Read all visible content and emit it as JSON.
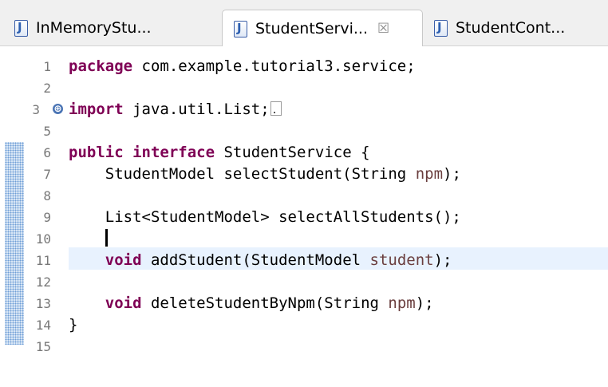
{
  "tabs": [
    {
      "label": "InMemoryStu...",
      "icon": "java-file-icon",
      "active": false
    },
    {
      "label": "StudentServi...",
      "icon": "java-file-icon",
      "active": true,
      "close_glyph": "☒"
    },
    {
      "label": "StudentCont...",
      "icon": "java-file-icon",
      "active": false
    }
  ],
  "editor": {
    "lines": [
      {
        "n": "1",
        "tokens": [
          {
            "t": "package",
            "k": "kw"
          },
          {
            "t": " com.example.tutorial3.service;"
          }
        ]
      },
      {
        "n": "2",
        "tokens": []
      },
      {
        "n": "3",
        "fold": "⊕",
        "tokens": [
          {
            "t": "import",
            "k": "kw"
          },
          {
            "t": " java.util.List;"
          }
        ],
        "collapsed": true
      },
      {
        "n": "5",
        "tokens": []
      },
      {
        "n": "6",
        "tokens": [
          {
            "t": "public",
            "k": "kw"
          },
          {
            "t": " "
          },
          {
            "t": "interface",
            "k": "kw"
          },
          {
            "t": " StudentService {"
          }
        ]
      },
      {
        "n": "7",
        "tokens": [
          {
            "t": "    StudentModel selectStudent(String "
          },
          {
            "t": "npm",
            "k": "param"
          },
          {
            "t": ");"
          }
        ]
      },
      {
        "n": "8",
        "tokens": []
      },
      {
        "n": "9",
        "tokens": [
          {
            "t": "    List<StudentModel> selectAllStudents();"
          }
        ]
      },
      {
        "n": "10",
        "tokens": [
          {
            "t": "    "
          }
        ],
        "caret": true,
        "current": true
      },
      {
        "n": "11",
        "tokens": [
          {
            "t": "    "
          },
          {
            "t": "void",
            "k": "kw"
          },
          {
            "t": " addStudent(StudentModel "
          },
          {
            "t": "student",
            "k": "param"
          },
          {
            "t": ");"
          }
        ]
      },
      {
        "n": "12",
        "tokens": []
      },
      {
        "n": "13",
        "tokens": [
          {
            "t": "    "
          },
          {
            "t": "void",
            "k": "kw"
          },
          {
            "t": " deleteStudentByNpm(String "
          },
          {
            "t": "npm",
            "k": "param"
          },
          {
            "t": ");"
          }
        ]
      },
      {
        "n": "14",
        "tokens": [
          {
            "t": "}"
          }
        ]
      },
      {
        "n": "15",
        "tokens": []
      }
    ]
  },
  "colors": {
    "keyword": "#7f0055",
    "parameter": "#6a3e3e",
    "line_number": "#787878",
    "current_line": "#e8f2fe",
    "change_bar": "#6f9fd6"
  }
}
